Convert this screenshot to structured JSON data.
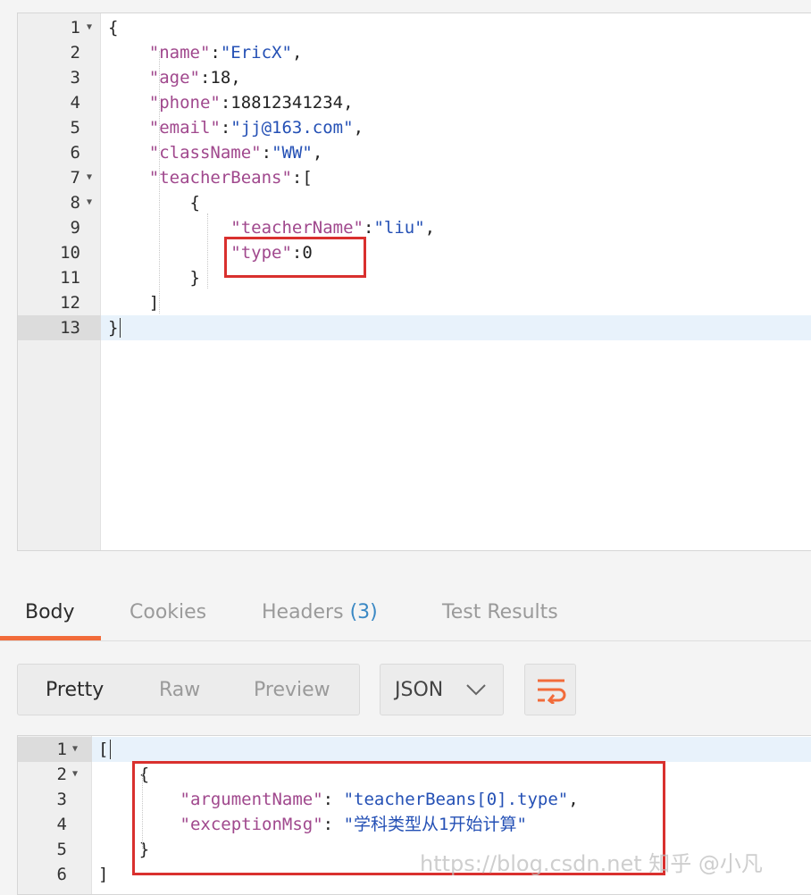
{
  "request_body": {
    "lines": [
      {
        "num": "1",
        "fold": true,
        "parts": [
          {
            "t": "{",
            "c": "punc"
          }
        ]
      },
      {
        "num": "2",
        "fold": false,
        "parts": [
          {
            "t": "    ",
            "c": "punc"
          },
          {
            "t": "\"name\"",
            "c": "key"
          },
          {
            "t": ":",
            "c": "punc"
          },
          {
            "t": "\"EricX\"",
            "c": "str"
          },
          {
            "t": ",",
            "c": "punc"
          }
        ]
      },
      {
        "num": "3",
        "fold": false,
        "parts": [
          {
            "t": "    ",
            "c": "punc"
          },
          {
            "t": "\"age\"",
            "c": "key"
          },
          {
            "t": ":18,",
            "c": "punc"
          }
        ]
      },
      {
        "num": "4",
        "fold": false,
        "parts": [
          {
            "t": "    ",
            "c": "punc"
          },
          {
            "t": "\"phone\"",
            "c": "key"
          },
          {
            "t": ":18812341234,",
            "c": "punc"
          }
        ]
      },
      {
        "num": "5",
        "fold": false,
        "parts": [
          {
            "t": "    ",
            "c": "punc"
          },
          {
            "t": "\"email\"",
            "c": "key"
          },
          {
            "t": ":",
            "c": "punc"
          },
          {
            "t": "\"jj@163.com\"",
            "c": "str"
          },
          {
            "t": ",",
            "c": "punc"
          }
        ]
      },
      {
        "num": "6",
        "fold": false,
        "parts": [
          {
            "t": "    ",
            "c": "punc"
          },
          {
            "t": "\"className\"",
            "c": "key"
          },
          {
            "t": ":",
            "c": "punc"
          },
          {
            "t": "\"WW\"",
            "c": "str"
          },
          {
            "t": ",",
            "c": "punc"
          }
        ]
      },
      {
        "num": "7",
        "fold": true,
        "parts": [
          {
            "t": "    ",
            "c": "punc"
          },
          {
            "t": "\"teacherBeans\"",
            "c": "key"
          },
          {
            "t": ":[",
            "c": "punc"
          }
        ]
      },
      {
        "num": "8",
        "fold": true,
        "parts": [
          {
            "t": "        {",
            "c": "punc"
          }
        ]
      },
      {
        "num": "9",
        "fold": false,
        "parts": [
          {
            "t": "            ",
            "c": "punc"
          },
          {
            "t": "\"teacherName\"",
            "c": "key"
          },
          {
            "t": ":",
            "c": "punc"
          },
          {
            "t": "\"liu\"",
            "c": "str"
          },
          {
            "t": ",",
            "c": "punc"
          }
        ]
      },
      {
        "num": "10",
        "fold": false,
        "parts": [
          {
            "t": "            ",
            "c": "punc"
          },
          {
            "t": "\"type\"",
            "c": "key"
          },
          {
            "t": ":0",
            "c": "punc"
          }
        ]
      },
      {
        "num": "11",
        "fold": false,
        "parts": [
          {
            "t": "        }",
            "c": "punc"
          }
        ]
      },
      {
        "num": "12",
        "fold": false,
        "parts": [
          {
            "t": "    ]",
            "c": "punc"
          }
        ]
      },
      {
        "num": "13",
        "fold": false,
        "active": true,
        "parts": [
          {
            "t": "}",
            "c": "punc"
          }
        ]
      }
    ]
  },
  "tabs": {
    "body": "Body",
    "cookies": "Cookies",
    "headers": "Headers",
    "headers_count": "(3)",
    "test_results": "Test Results"
  },
  "view_modes": {
    "pretty": "Pretty",
    "raw": "Raw",
    "preview": "Preview"
  },
  "format": {
    "selected": "JSON"
  },
  "icons": {
    "format_dropdown": "chevron-down-icon",
    "wrap": "wrap-lines-icon",
    "fold": "fold-arrow-icon"
  },
  "response_body": {
    "lines": [
      {
        "num": "1",
        "fold": true,
        "active": true,
        "parts": [
          {
            "t": "[",
            "c": "punc"
          }
        ]
      },
      {
        "num": "2",
        "fold": true,
        "parts": [
          {
            "t": "    {",
            "c": "punc"
          }
        ]
      },
      {
        "num": "3",
        "fold": false,
        "parts": [
          {
            "t": "        ",
            "c": "punc"
          },
          {
            "t": "\"argumentName\"",
            "c": "key"
          },
          {
            "t": ": ",
            "c": "punc"
          },
          {
            "t": "\"teacherBeans[0].type\"",
            "c": "str"
          },
          {
            "t": ",",
            "c": "punc"
          }
        ]
      },
      {
        "num": "4",
        "fold": false,
        "parts": [
          {
            "t": "        ",
            "c": "punc"
          },
          {
            "t": "\"exceptionMsg\"",
            "c": "key"
          },
          {
            "t": ": ",
            "c": "punc"
          },
          {
            "t": "\"学科类型从1开始计算\"",
            "c": "str"
          }
        ]
      },
      {
        "num": "5",
        "fold": false,
        "parts": [
          {
            "t": "    }",
            "c": "punc"
          }
        ]
      },
      {
        "num": "6",
        "fold": false,
        "parts": [
          {
            "t": "]",
            "c": "punc"
          }
        ]
      }
    ]
  },
  "watermark": "https://blog.csdn.net 知乎 @小凡",
  "colors": {
    "accent": "#f26b3a",
    "highlight": "#d9302e",
    "key": "#a0488d",
    "string": "#2450b5",
    "count": "#3a88c4"
  }
}
